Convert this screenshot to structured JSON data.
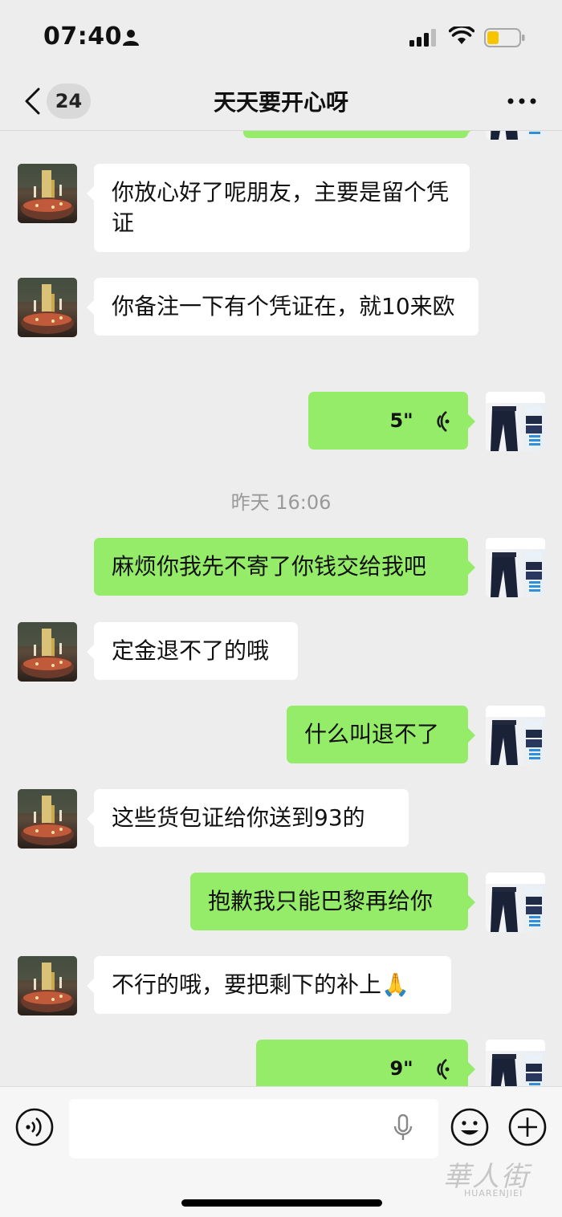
{
  "status": {
    "time": "07:40"
  },
  "nav": {
    "unread_count": "24",
    "title": "天天要开心呀"
  },
  "messages": [
    {
      "side": "in",
      "text": "你放心好了呢朋友，主要是留个凭证"
    },
    {
      "side": "in",
      "text": "你备注一下有个凭证在，就10来欧"
    },
    {
      "side": "out",
      "type": "voice",
      "duration": "5\""
    },
    {
      "side": "out",
      "text": "麻烦你我先不寄了你钱交给我吧"
    },
    {
      "side": "in",
      "text": "定金退不了的哦"
    },
    {
      "side": "out",
      "text": "什么叫退不了"
    },
    {
      "side": "in",
      "text": "这些货包证给你送到93的"
    },
    {
      "side": "out",
      "text": "抱歉我只能巴黎再给你"
    },
    {
      "side": "in",
      "text": "不行的哦，要把剩下的补上🙏"
    },
    {
      "side": "out",
      "type": "voice",
      "duration": "9\""
    }
  ],
  "timestamp": "昨天 16:06",
  "watermark": {
    "logo": "華人街",
    "sub": "HUARENJIEI"
  },
  "icons": {
    "back": "chevron-left-icon",
    "more": "more-dots-icon",
    "voice_mode": "voice-mode-icon",
    "mic": "mic-icon",
    "emoji": "emoji-icon",
    "plus": "plus-icon"
  },
  "colors": {
    "out_bubble": "#95ec69",
    "in_bubble": "#ffffff",
    "background": "#ededed"
  }
}
